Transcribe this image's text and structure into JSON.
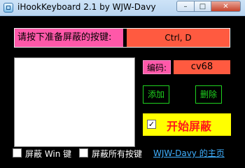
{
  "window": {
    "title": "iHookKeyboard 2.1 by WJW-Davy",
    "controls": {
      "minimize": "–",
      "maximize": "□",
      "close": "✕"
    }
  },
  "hotkey": {
    "label": "请按下准备屏蔽的按键:",
    "value": "Ctrl, D"
  },
  "key_list": {
    "items": []
  },
  "code": {
    "label": "编码:",
    "value": "cv68"
  },
  "buttons": {
    "add": "添加",
    "delete": "删除"
  },
  "start": {
    "checked": true,
    "check_mark": "✓",
    "label": "开始屏蔽"
  },
  "options": {
    "block_win_key": "屏蔽 Win 键",
    "block_all_keys": "屏蔽所有按键"
  },
  "link": {
    "text": "WJW-Davy 的主页"
  },
  "colors": {
    "background": "#000000",
    "pink": "#ff58a9",
    "orange_red": "#ff5a40",
    "green": "#1fd11f",
    "yellow": "#ffff00",
    "red_text": "#ff1a1a",
    "link": "#3fb0ff"
  },
  "icons": {
    "app": "keyboard-app-icon"
  }
}
